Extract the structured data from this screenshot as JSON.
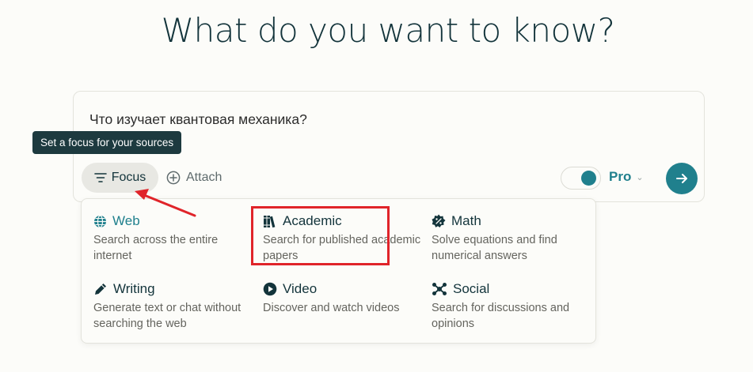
{
  "heading": "What do you want to know?",
  "query": "Что изучает квантовая механика?",
  "tooltip": "Set a focus for your sources",
  "toolbar": {
    "focus_label": "Focus",
    "attach_label": "Attach",
    "pro_label": "Pro",
    "pro_enabled": true
  },
  "focus_options": [
    {
      "title": "Web",
      "description": "Search across the entire internet",
      "icon": "globe-icon",
      "active": true
    },
    {
      "title": "Academic",
      "description": "Search for published academic papers",
      "icon": "books-icon",
      "active": false,
      "highlighted": true
    },
    {
      "title": "Math",
      "description": "Solve equations and find numerical answers",
      "icon": "math-badge-icon",
      "active": false
    },
    {
      "title": "Writing",
      "description": "Generate text or chat without searching the web",
      "icon": "pen-icon",
      "active": false
    },
    {
      "title": "Video",
      "description": "Discover and watch videos",
      "icon": "play-icon",
      "active": false
    },
    {
      "title": "Social",
      "description": "Search for discussions and opinions",
      "icon": "social-nodes-icon",
      "active": false
    }
  ],
  "colors": {
    "accent": "#20808d",
    "text": "#13343b",
    "muted": "#64645e",
    "annotation": "#e0242a",
    "tooltip_bg": "#1d3a3f"
  }
}
